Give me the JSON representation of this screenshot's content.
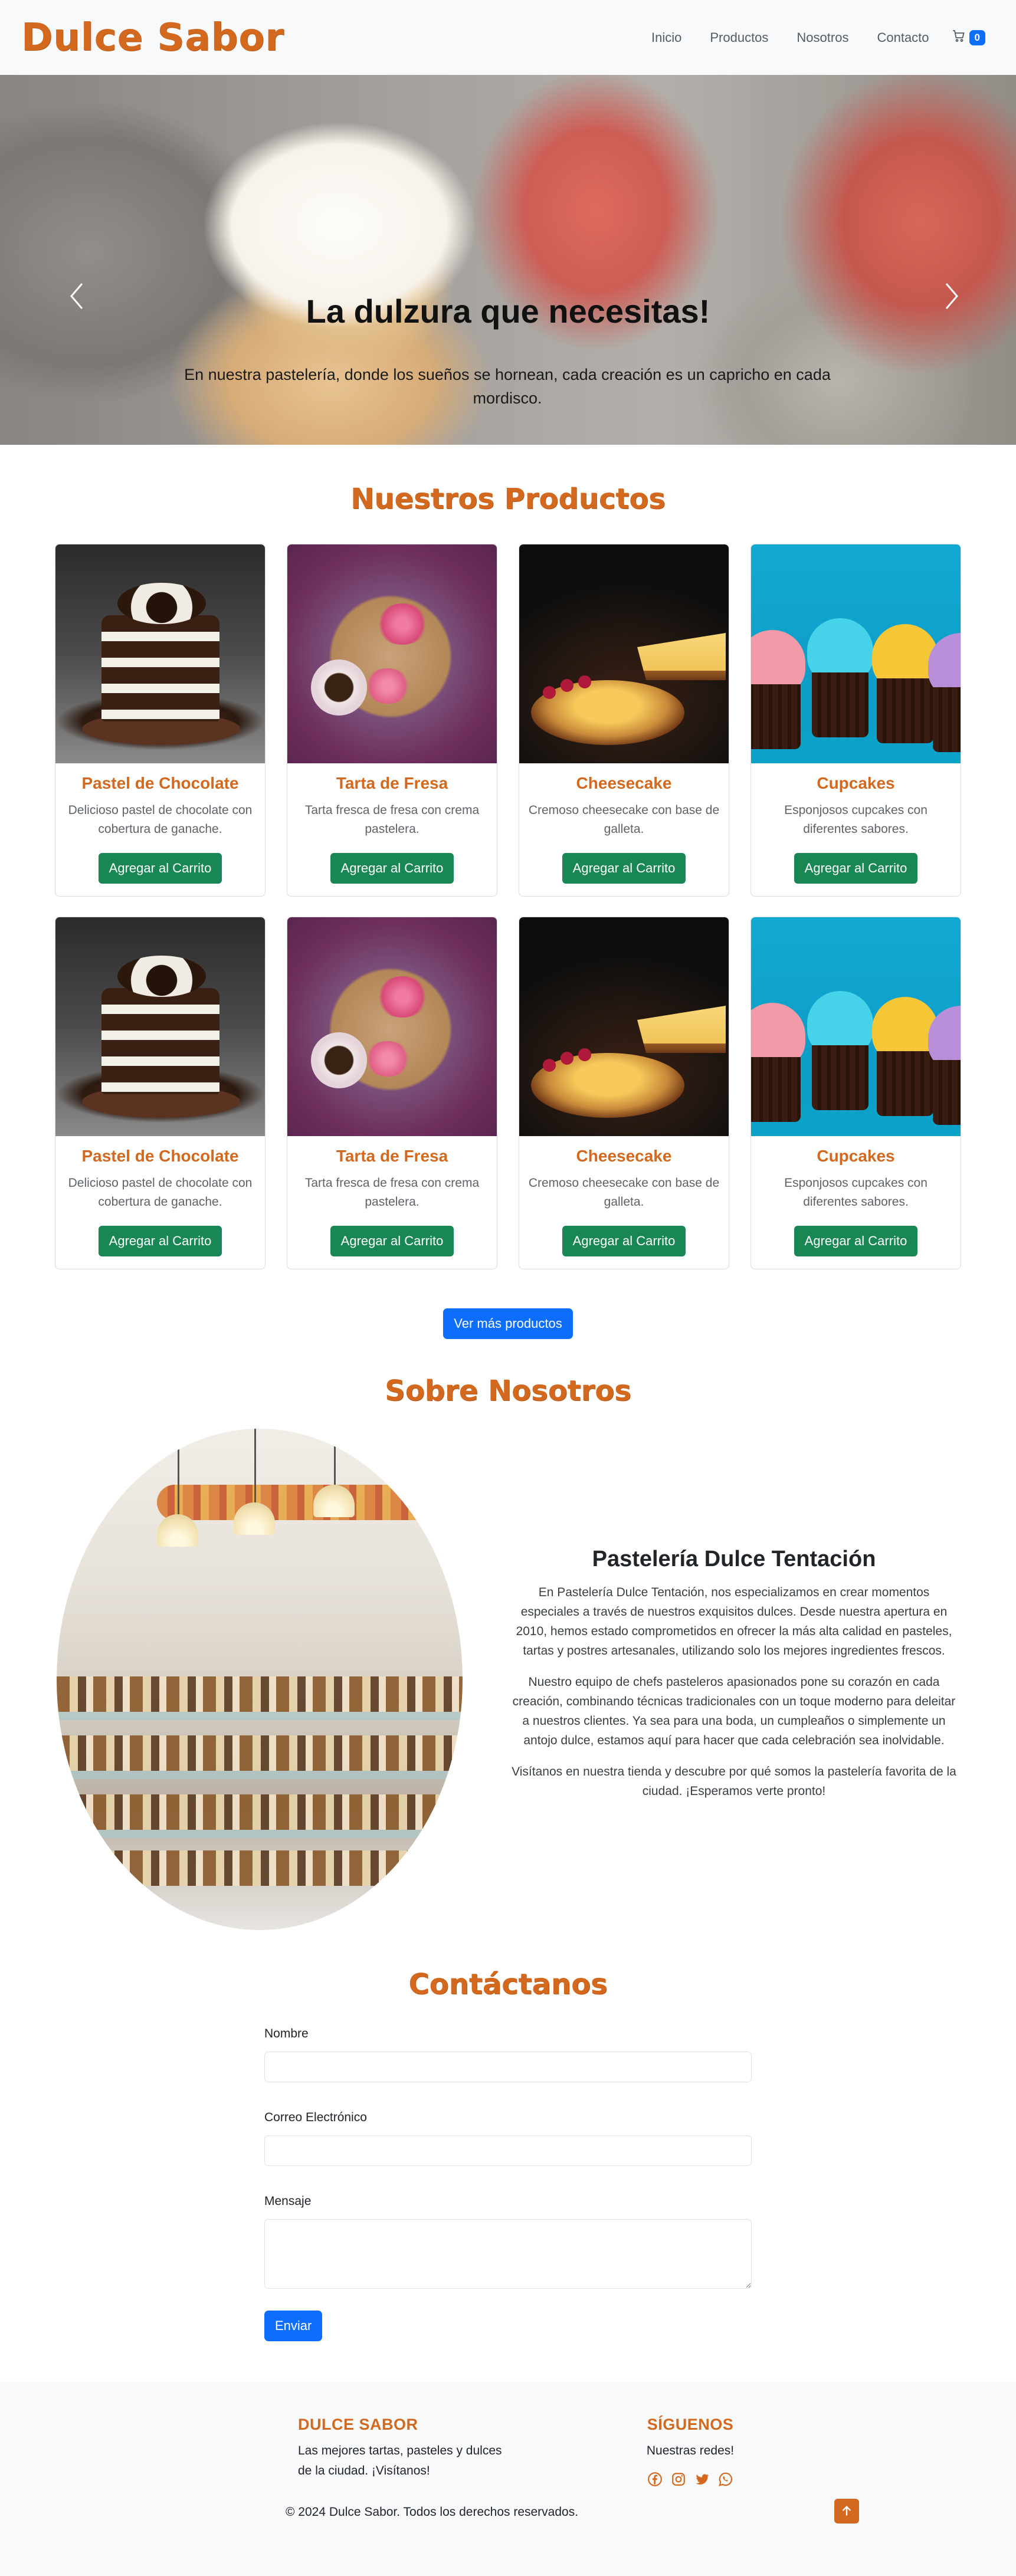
{
  "brand": "Dulce Sabor",
  "nav": {
    "links": [
      "Inicio",
      "Productos",
      "Nosotros",
      "Contacto"
    ],
    "cart_count": "0"
  },
  "hero": {
    "title": "La dulzura que necesitas!",
    "text": "En nuestra pastelería, donde los sueños se hornean, cada creación es un capricho en cada mordisco."
  },
  "products": {
    "title": "Nuestros Productos",
    "items": [
      {
        "name": "Pastel de Chocolate",
        "desc": "Delicioso pastel de chocolate con cobertura de ganache.",
        "button": "Agregar al Carrito"
      },
      {
        "name": "Tarta de Fresa",
        "desc": "Tarta fresca de fresa con crema pastelera.",
        "button": "Agregar al Carrito"
      },
      {
        "name": "Cheesecake",
        "desc": "Cremoso cheesecake con base de galleta.",
        "button": "Agregar al Carrito"
      },
      {
        "name": "Cupcakes",
        "desc": "Esponjosos cupcakes con diferentes sabores.",
        "button": "Agregar al Carrito"
      },
      {
        "name": "Pastel de Chocolate",
        "desc": "Delicioso pastel de chocolate con cobertura de ganache.",
        "button": "Agregar al Carrito"
      },
      {
        "name": "Tarta de Fresa",
        "desc": "Tarta fresca de fresa con crema pastelera.",
        "button": "Agregar al Carrito"
      },
      {
        "name": "Cheesecake",
        "desc": "Cremoso cheesecake con base de galleta.",
        "button": "Agregar al Carrito"
      },
      {
        "name": "Cupcakes",
        "desc": "Esponjosos cupcakes con diferentes sabores.",
        "button": "Agregar al Carrito"
      }
    ],
    "more_button": "Ver más productos"
  },
  "about": {
    "title": "Sobre Nosotros",
    "heading": "Pastelería Dulce Tentación",
    "paragraphs": [
      "En Pastelería Dulce Tentación, nos especializamos en crear momentos especiales a través de nuestros exquisitos dulces. Desde nuestra apertura en 2010, hemos estado comprometidos en ofrecer la más alta calidad en pasteles, tartas y postres artesanales, utilizando solo los mejores ingredientes frescos.",
      "Nuestro equipo de chefs pasteleros apasionados pone su corazón en cada creación, combinando técnicas tradicionales con un toque moderno para deleitar a nuestros clientes. Ya sea para una boda, un cumpleaños o simplemente un antojo dulce, estamos aquí para hacer que cada celebración sea inolvidable.",
      "Visítanos en nuestra tienda y descubre por qué somos la pastelería favorita de la ciudad. ¡Esperamos verte pronto!"
    ]
  },
  "contact": {
    "title": "Contáctanos",
    "name_label": "Nombre",
    "email_label": "Correo Electrónico",
    "message_label": "Mensaje",
    "submit": "Enviar"
  },
  "footer": {
    "brand_title": "DULCE SABOR",
    "brand_text": "Las mejores tartas, pasteles y dulces de la ciudad. ¡Visítanos!",
    "social_title": "SÍGUENOS",
    "social_text": "Nuestras redes!",
    "social_icons": [
      "facebook-icon",
      "instagram-icon",
      "twitter-icon",
      "whatsapp-icon"
    ],
    "copyright": "© 2024 Dulce Sabor. Todos los derechos reservados."
  },
  "colors": {
    "accent": "#d2691e",
    "primary_button": "#0d6efd",
    "success_button": "#198754"
  }
}
